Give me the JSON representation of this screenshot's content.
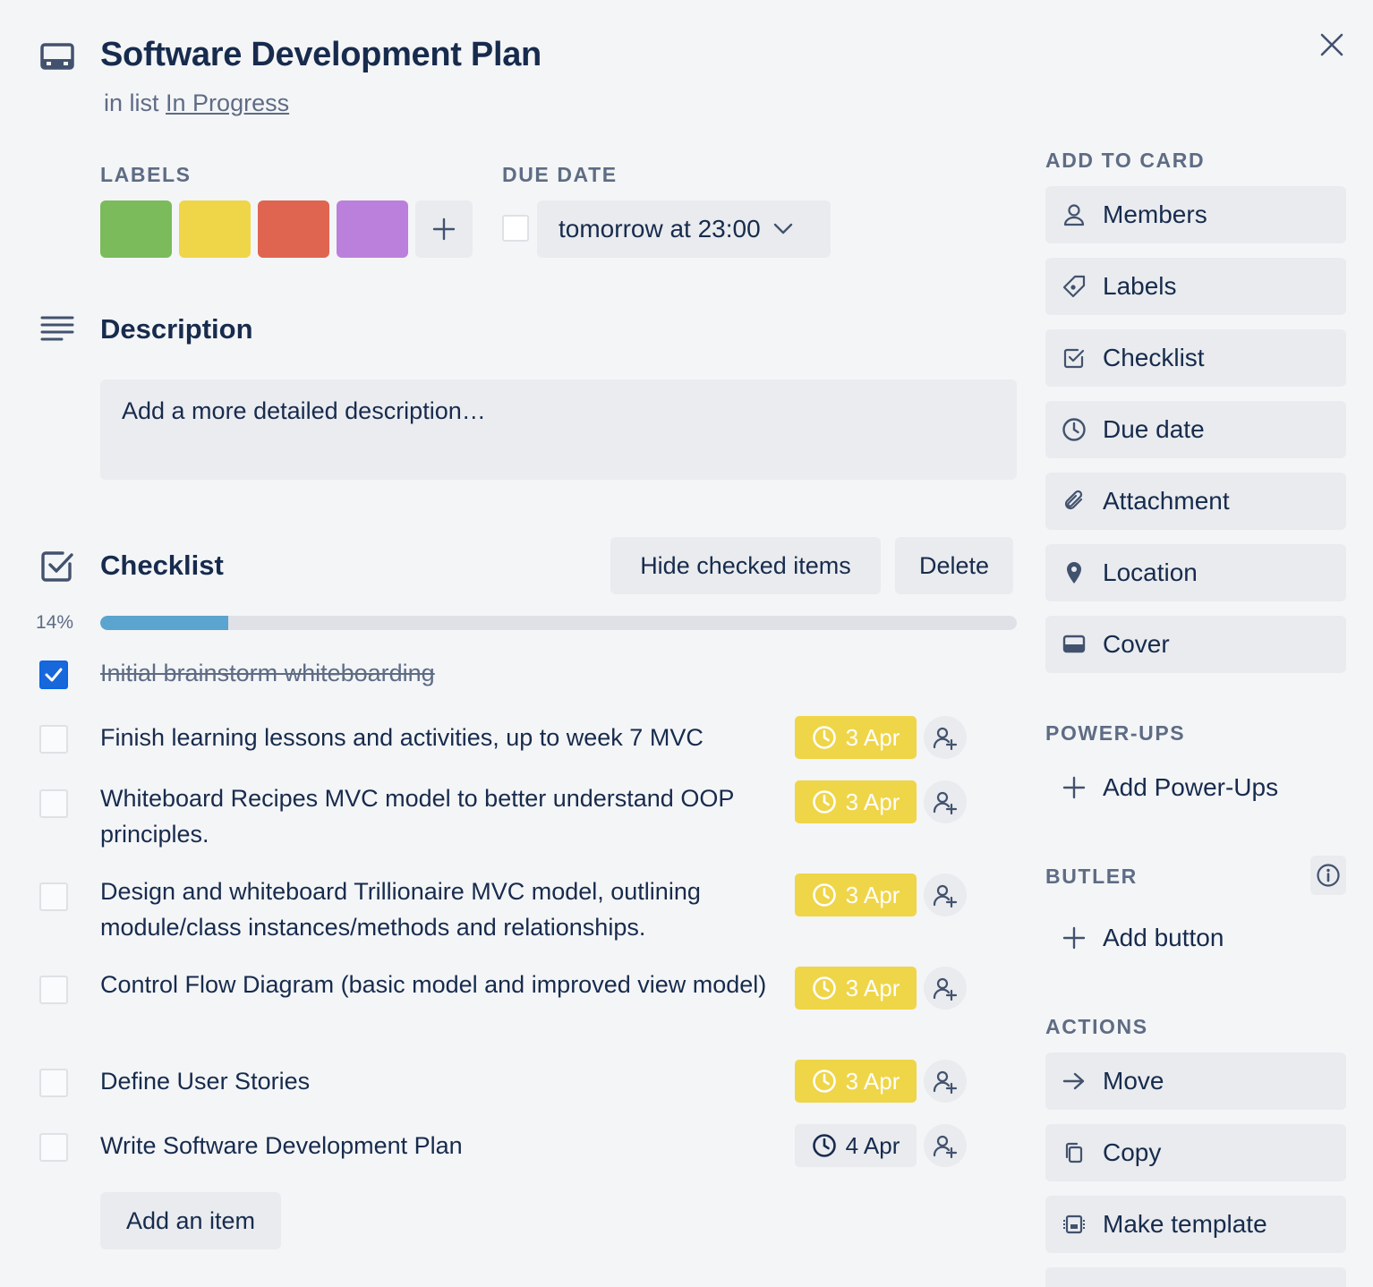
{
  "card": {
    "title": "Software Development Plan",
    "in_list_prefix": "in list",
    "list_name": "In Progress"
  },
  "labels": {
    "heading": "LABELS",
    "colors": [
      "#7bbb5b",
      "#efd548",
      "#df6550",
      "#bb80db"
    ]
  },
  "due_date": {
    "heading": "DUE DATE",
    "value": "tomorrow at 23:00"
  },
  "description": {
    "heading": "Description",
    "placeholder": "Add a more detailed description…"
  },
  "checklist": {
    "heading": "Checklist",
    "hide_checked_label": "Hide checked items",
    "delete_label": "Delete",
    "progress_text": "14%",
    "progress": 0.14,
    "items": [
      {
        "text": "Initial brainstorm whiteboarding",
        "done": true
      },
      {
        "text": "Finish learning lessons and activities, up to week 7 MVC",
        "done": false,
        "due": "3 Apr",
        "due_style": "yellow"
      },
      {
        "text": "Whiteboard Recipes MVC model to better understand OOP principles.",
        "done": false,
        "due": "3 Apr",
        "due_style": "yellow"
      },
      {
        "text": "Design and whiteboard Trillionaire MVC model, outlining module/class instances/methods and relationships.",
        "done": false,
        "due": "3 Apr",
        "due_style": "yellow"
      },
      {
        "text": "Control Flow Diagram (basic model and improved view model)",
        "done": false,
        "due": "3 Apr",
        "due_style": "yellow"
      },
      {
        "text": "Define User Stories",
        "done": false,
        "due": "3 Apr",
        "due_style": "yellow"
      },
      {
        "text": "Write Software Development Plan",
        "done": false,
        "due": "4 Apr",
        "due_style": "grey"
      }
    ],
    "add_item_label": "Add an item"
  },
  "sidebar": {
    "add_to_card_heading": "ADD TO CARD",
    "add_to_card": [
      {
        "label": "Members",
        "icon": "person-icon"
      },
      {
        "label": "Labels",
        "icon": "tag-icon"
      },
      {
        "label": "Checklist",
        "icon": "checkbox-icon"
      },
      {
        "label": "Due date",
        "icon": "clock-icon"
      },
      {
        "label": "Attachment",
        "icon": "paperclip-icon"
      },
      {
        "label": "Location",
        "icon": "pin-icon"
      },
      {
        "label": "Cover",
        "icon": "cover-icon"
      }
    ],
    "power_ups_heading": "POWER-UPS",
    "add_power_ups_label": "Add Power-Ups",
    "butler_heading": "BUTLER",
    "add_button_label": "Add button",
    "actions_heading": "ACTIONS",
    "actions": [
      {
        "label": "Move",
        "icon": "arrow-right-icon"
      },
      {
        "label": "Copy",
        "icon": "copy-icon"
      },
      {
        "label": "Make template",
        "icon": "template-icon"
      }
    ]
  }
}
